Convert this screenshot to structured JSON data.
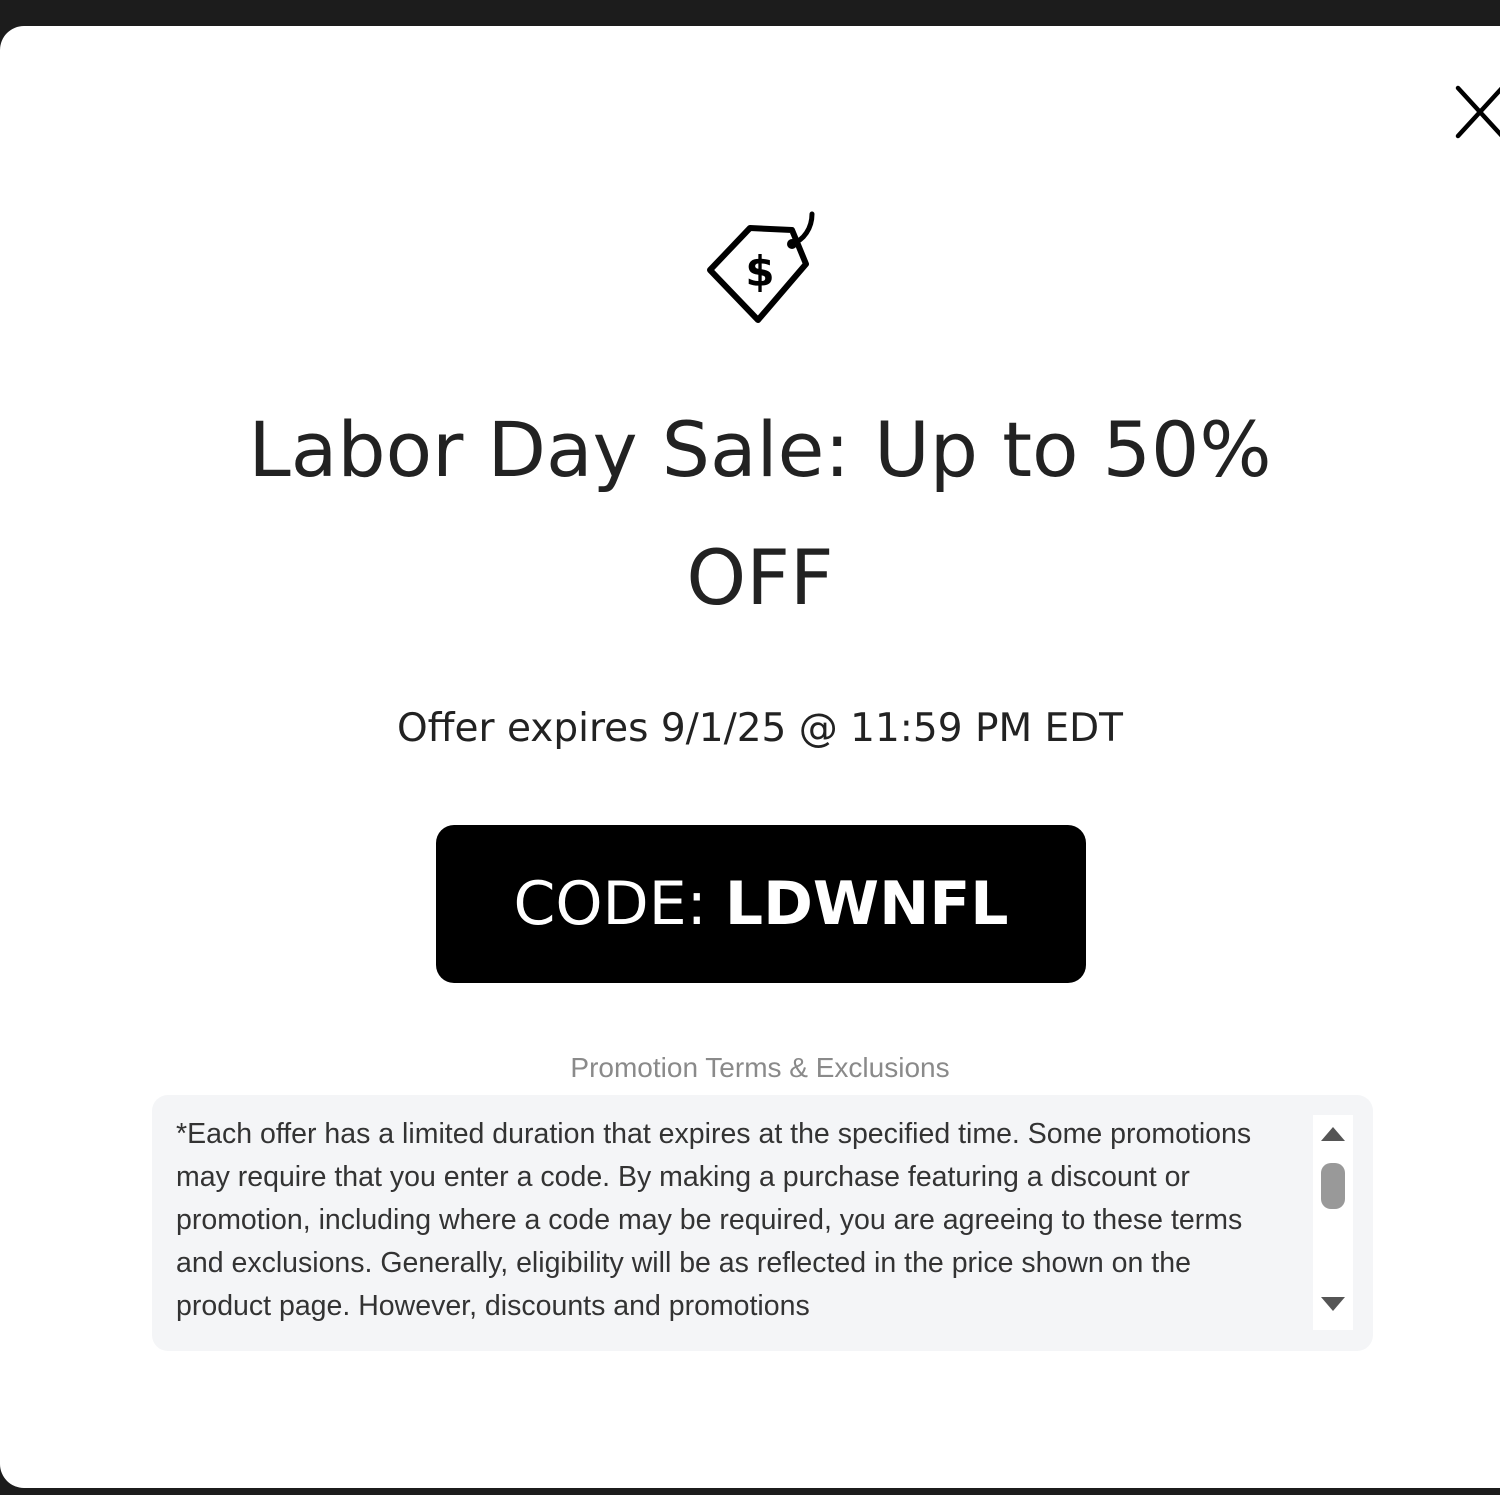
{
  "modal": {
    "close_icon": "close-x-icon",
    "tag_icon": "dollar-price-tag-icon",
    "headline_line1": "Labor Day Sale: Up to 50%",
    "headline_line2": "OFF",
    "expires_text": "Offer expires 9/1/25 @ 11:59 PM EDT",
    "code_label": "CODE:",
    "code_value": "LDWNFL",
    "terms_title": "Promotion Terms & Exclusions",
    "terms_text": "*Each offer has a limited duration that expires at the specified time. Some promotions may require that you enter a code. By making a purchase featuring a discount or promotion, including where a code may be required, you are agreeing to these terms and exclusions. Generally, eligibility will be as reflected in the price shown on the product page. However, discounts and promotions"
  },
  "colors": {
    "code_button_bg": "#000000",
    "terms_bg": "#f4f5f7",
    "terms_title": "#8a8a8a",
    "text": "#222222"
  }
}
